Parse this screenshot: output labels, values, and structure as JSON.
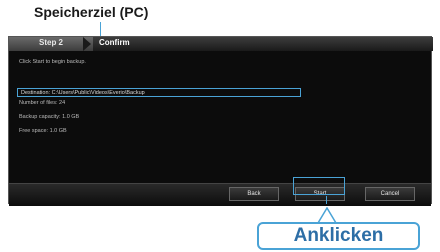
{
  "annotation": {
    "destination_caption": "Speicherziel (PC)",
    "click_caption": "Anklicken"
  },
  "wizard": {
    "step": "Step 2",
    "current_step": "Confirm",
    "intro_text": "Click Start to begin backup.",
    "destination": "Destination: C:\\Users\\Public\\Videos\\Everio\\Backup",
    "info": [
      "Number of files: 24",
      "Backup capacity: 1.0 GB",
      "Free space: 1.0 GB"
    ]
  },
  "buttons": {
    "back": "Back",
    "start": "Start",
    "cancel": "Cancel"
  },
  "colors": {
    "annotation_accent": "#4aa3d6",
    "callout_text": "#2d6ea6",
    "window_bg": "#0c0c0c"
  }
}
